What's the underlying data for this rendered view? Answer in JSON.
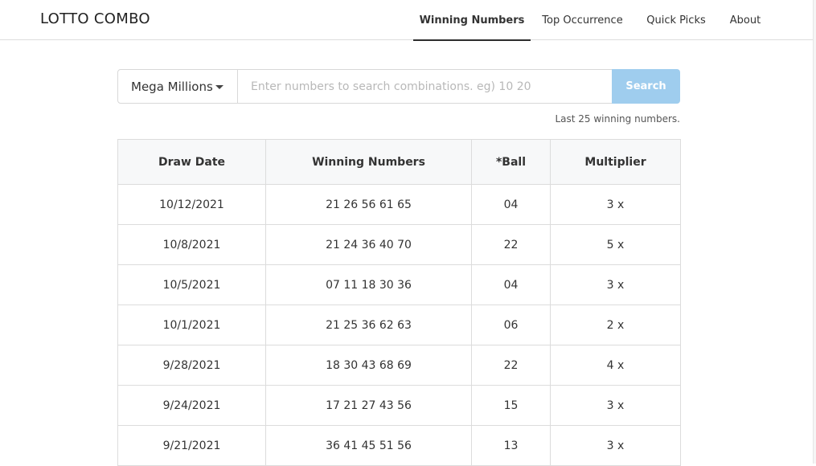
{
  "header": {
    "brand": "LOTTO COMBO",
    "nav": [
      {
        "label": "Winning Numbers",
        "active": true
      },
      {
        "label": "Top Occurrence",
        "active": false
      },
      {
        "label": "Quick Picks",
        "active": false
      },
      {
        "label": "About",
        "active": false
      }
    ]
  },
  "search": {
    "game_selected": "Mega Millions",
    "placeholder": "Enter numbers to search combinations. eg) 10 20",
    "value": "",
    "button_label": "Search"
  },
  "results": {
    "caption": "Last 25 winning numbers.",
    "columns": [
      "Draw Date",
      "Winning Numbers",
      "*Ball",
      "Multiplier"
    ],
    "rows": [
      {
        "date": "10/12/2021",
        "numbers": "21 26 56 61 65",
        "ball": "04",
        "multiplier": "3 x"
      },
      {
        "date": "10/8/2021",
        "numbers": "21 24 36 40 70",
        "ball": "22",
        "multiplier": "5 x"
      },
      {
        "date": "10/5/2021",
        "numbers": "07 11 18 30 36",
        "ball": "04",
        "multiplier": "3 x"
      },
      {
        "date": "10/1/2021",
        "numbers": "21 25 36 62 63",
        "ball": "06",
        "multiplier": "2 x"
      },
      {
        "date": "9/28/2021",
        "numbers": "18 30 43 68 69",
        "ball": "22",
        "multiplier": "4 x"
      },
      {
        "date": "9/24/2021",
        "numbers": "17 21 27 43 56",
        "ball": "15",
        "multiplier": "3 x"
      },
      {
        "date": "9/21/2021",
        "numbers": "36 41 45 51 56",
        "ball": "13",
        "multiplier": "3 x"
      }
    ]
  },
  "colors": {
    "search_button": "#9fcdee",
    "active_underline": "#2d2d2d",
    "header_row_bg": "#f7f8f9"
  },
  "icons": {
    "dropdown": "caret-down-icon"
  }
}
